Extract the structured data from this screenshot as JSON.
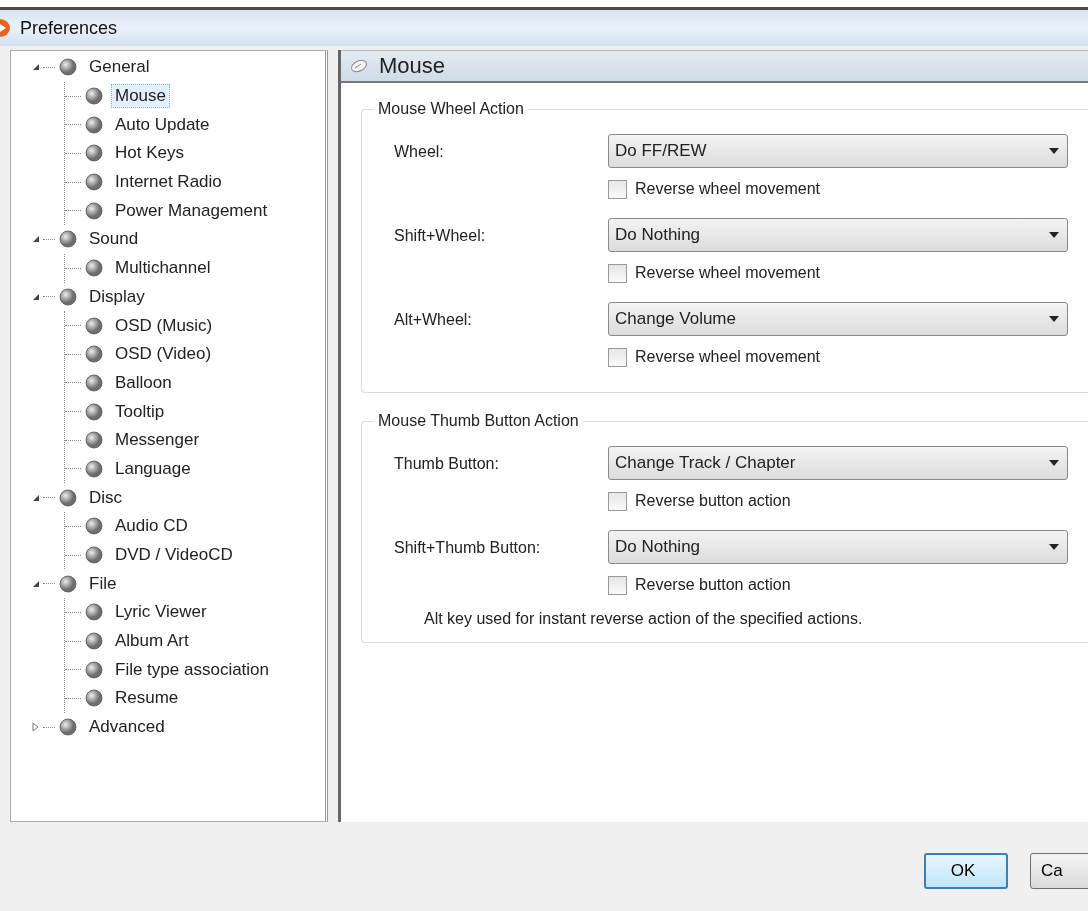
{
  "window": {
    "title": "Preferences"
  },
  "tree": [
    {
      "label": "General",
      "expanded": true,
      "selected": false,
      "children": [
        {
          "label": "Mouse",
          "selected": true
        },
        {
          "label": "Auto Update",
          "selected": false
        },
        {
          "label": "Hot Keys",
          "selected": false
        },
        {
          "label": "Internet Radio",
          "selected": false
        },
        {
          "label": "Power Management",
          "selected": false
        }
      ]
    },
    {
      "label": "Sound",
      "expanded": true,
      "selected": false,
      "children": [
        {
          "label": "Multichannel",
          "selected": false
        }
      ]
    },
    {
      "label": "Display",
      "expanded": true,
      "selected": false,
      "children": [
        {
          "label": "OSD (Music)",
          "selected": false
        },
        {
          "label": "OSD (Video)",
          "selected": false
        },
        {
          "label": "Balloon",
          "selected": false
        },
        {
          "label": "Tooltip",
          "selected": false
        },
        {
          "label": "Messenger",
          "selected": false
        },
        {
          "label": "Language",
          "selected": false
        }
      ]
    },
    {
      "label": "Disc",
      "expanded": true,
      "selected": false,
      "children": [
        {
          "label": "Audio CD",
          "selected": false
        },
        {
          "label": "DVD / VideoCD",
          "selected": false
        }
      ]
    },
    {
      "label": "File",
      "expanded": true,
      "selected": false,
      "children": [
        {
          "label": "Lyric Viewer",
          "selected": false
        },
        {
          "label": "Album Art",
          "selected": false
        },
        {
          "label": "File type association",
          "selected": false
        },
        {
          "label": "Resume",
          "selected": false
        }
      ]
    },
    {
      "label": "Advanced",
      "expanded": false,
      "selected": false
    }
  ],
  "panel": {
    "title": "Mouse",
    "groups": [
      {
        "title": "Mouse Wheel Action",
        "rows": [
          {
            "label": "Wheel:",
            "value": "Do FF/REW",
            "option": {
              "label": "Reverse wheel movement",
              "checked": false
            }
          },
          {
            "label": "Shift+Wheel:",
            "value": "Do Nothing",
            "option": {
              "label": "Reverse wheel movement",
              "checked": false
            }
          },
          {
            "label": "Alt+Wheel:",
            "value": "Change Volume",
            "option": {
              "label": "Reverse wheel movement",
              "checked": false
            }
          }
        ]
      },
      {
        "title": "Mouse Thumb Button Action",
        "rows": [
          {
            "label": "Thumb Button:",
            "value": "Change Track / Chapter",
            "option": {
              "label": "Reverse button action",
              "checked": false
            }
          },
          {
            "label": "Shift+Thumb Button:",
            "value": "Do Nothing",
            "option": {
              "label": "Reverse button action",
              "checked": false
            }
          }
        ],
        "note": "Alt key used for instant reverse action of the specified actions."
      }
    ]
  },
  "buttons": [
    "OK",
    "Ca"
  ]
}
